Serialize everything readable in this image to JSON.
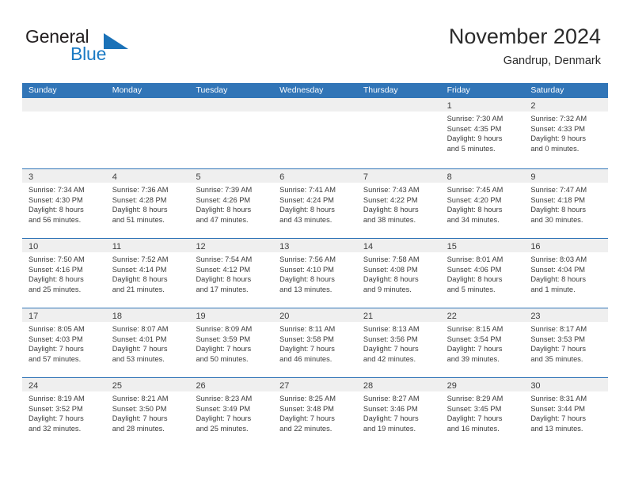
{
  "logo": {
    "word1": "General",
    "word2": "Blue",
    "triangle_icon": "triangle-icon",
    "color_dark": "#231f20",
    "color_blue": "#1b7ac4"
  },
  "header": {
    "title": "November 2024",
    "location": "Gandrup, Denmark"
  },
  "theme": {
    "header_blue": "#3175b7",
    "date_band_gray": "#efefef",
    "text": "#3c3c3c"
  },
  "calendar": {
    "weekdays": [
      "Sunday",
      "Monday",
      "Tuesday",
      "Wednesday",
      "Thursday",
      "Friday",
      "Saturday"
    ],
    "weeks": [
      [
        {
          "day": "",
          "empty": true
        },
        {
          "day": "",
          "empty": true
        },
        {
          "day": "",
          "empty": true
        },
        {
          "day": "",
          "empty": true
        },
        {
          "day": "",
          "empty": true
        },
        {
          "day": "1",
          "sunrise": "Sunrise: 7:30 AM",
          "sunset": "Sunset: 4:35 PM",
          "daylight1": "Daylight: 9 hours",
          "daylight2": "and 5 minutes."
        },
        {
          "day": "2",
          "sunrise": "Sunrise: 7:32 AM",
          "sunset": "Sunset: 4:33 PM",
          "daylight1": "Daylight: 9 hours",
          "daylight2": "and 0 minutes."
        }
      ],
      [
        {
          "day": "3",
          "sunrise": "Sunrise: 7:34 AM",
          "sunset": "Sunset: 4:30 PM",
          "daylight1": "Daylight: 8 hours",
          "daylight2": "and 56 minutes."
        },
        {
          "day": "4",
          "sunrise": "Sunrise: 7:36 AM",
          "sunset": "Sunset: 4:28 PM",
          "daylight1": "Daylight: 8 hours",
          "daylight2": "and 51 minutes."
        },
        {
          "day": "5",
          "sunrise": "Sunrise: 7:39 AM",
          "sunset": "Sunset: 4:26 PM",
          "daylight1": "Daylight: 8 hours",
          "daylight2": "and 47 minutes."
        },
        {
          "day": "6",
          "sunrise": "Sunrise: 7:41 AM",
          "sunset": "Sunset: 4:24 PM",
          "daylight1": "Daylight: 8 hours",
          "daylight2": "and 43 minutes."
        },
        {
          "day": "7",
          "sunrise": "Sunrise: 7:43 AM",
          "sunset": "Sunset: 4:22 PM",
          "daylight1": "Daylight: 8 hours",
          "daylight2": "and 38 minutes."
        },
        {
          "day": "8",
          "sunrise": "Sunrise: 7:45 AM",
          "sunset": "Sunset: 4:20 PM",
          "daylight1": "Daylight: 8 hours",
          "daylight2": "and 34 minutes."
        },
        {
          "day": "9",
          "sunrise": "Sunrise: 7:47 AM",
          "sunset": "Sunset: 4:18 PM",
          "daylight1": "Daylight: 8 hours",
          "daylight2": "and 30 minutes."
        }
      ],
      [
        {
          "day": "10",
          "sunrise": "Sunrise: 7:50 AM",
          "sunset": "Sunset: 4:16 PM",
          "daylight1": "Daylight: 8 hours",
          "daylight2": "and 25 minutes."
        },
        {
          "day": "11",
          "sunrise": "Sunrise: 7:52 AM",
          "sunset": "Sunset: 4:14 PM",
          "daylight1": "Daylight: 8 hours",
          "daylight2": "and 21 minutes."
        },
        {
          "day": "12",
          "sunrise": "Sunrise: 7:54 AM",
          "sunset": "Sunset: 4:12 PM",
          "daylight1": "Daylight: 8 hours",
          "daylight2": "and 17 minutes."
        },
        {
          "day": "13",
          "sunrise": "Sunrise: 7:56 AM",
          "sunset": "Sunset: 4:10 PM",
          "daylight1": "Daylight: 8 hours",
          "daylight2": "and 13 minutes."
        },
        {
          "day": "14",
          "sunrise": "Sunrise: 7:58 AM",
          "sunset": "Sunset: 4:08 PM",
          "daylight1": "Daylight: 8 hours",
          "daylight2": "and 9 minutes."
        },
        {
          "day": "15",
          "sunrise": "Sunrise: 8:01 AM",
          "sunset": "Sunset: 4:06 PM",
          "daylight1": "Daylight: 8 hours",
          "daylight2": "and 5 minutes."
        },
        {
          "day": "16",
          "sunrise": "Sunrise: 8:03 AM",
          "sunset": "Sunset: 4:04 PM",
          "daylight1": "Daylight: 8 hours",
          "daylight2": "and 1 minute."
        }
      ],
      [
        {
          "day": "17",
          "sunrise": "Sunrise: 8:05 AM",
          "sunset": "Sunset: 4:03 PM",
          "daylight1": "Daylight: 7 hours",
          "daylight2": "and 57 minutes."
        },
        {
          "day": "18",
          "sunrise": "Sunrise: 8:07 AM",
          "sunset": "Sunset: 4:01 PM",
          "daylight1": "Daylight: 7 hours",
          "daylight2": "and 53 minutes."
        },
        {
          "day": "19",
          "sunrise": "Sunrise: 8:09 AM",
          "sunset": "Sunset: 3:59 PM",
          "daylight1": "Daylight: 7 hours",
          "daylight2": "and 50 minutes."
        },
        {
          "day": "20",
          "sunrise": "Sunrise: 8:11 AM",
          "sunset": "Sunset: 3:58 PM",
          "daylight1": "Daylight: 7 hours",
          "daylight2": "and 46 minutes."
        },
        {
          "day": "21",
          "sunrise": "Sunrise: 8:13 AM",
          "sunset": "Sunset: 3:56 PM",
          "daylight1": "Daylight: 7 hours",
          "daylight2": "and 42 minutes."
        },
        {
          "day": "22",
          "sunrise": "Sunrise: 8:15 AM",
          "sunset": "Sunset: 3:54 PM",
          "daylight1": "Daylight: 7 hours",
          "daylight2": "and 39 minutes."
        },
        {
          "day": "23",
          "sunrise": "Sunrise: 8:17 AM",
          "sunset": "Sunset: 3:53 PM",
          "daylight1": "Daylight: 7 hours",
          "daylight2": "and 35 minutes."
        }
      ],
      [
        {
          "day": "24",
          "sunrise": "Sunrise: 8:19 AM",
          "sunset": "Sunset: 3:52 PM",
          "daylight1": "Daylight: 7 hours",
          "daylight2": "and 32 minutes."
        },
        {
          "day": "25",
          "sunrise": "Sunrise: 8:21 AM",
          "sunset": "Sunset: 3:50 PM",
          "daylight1": "Daylight: 7 hours",
          "daylight2": "and 28 minutes."
        },
        {
          "day": "26",
          "sunrise": "Sunrise: 8:23 AM",
          "sunset": "Sunset: 3:49 PM",
          "daylight1": "Daylight: 7 hours",
          "daylight2": "and 25 minutes."
        },
        {
          "day": "27",
          "sunrise": "Sunrise: 8:25 AM",
          "sunset": "Sunset: 3:48 PM",
          "daylight1": "Daylight: 7 hours",
          "daylight2": "and 22 minutes."
        },
        {
          "day": "28",
          "sunrise": "Sunrise: 8:27 AM",
          "sunset": "Sunset: 3:46 PM",
          "daylight1": "Daylight: 7 hours",
          "daylight2": "and 19 minutes."
        },
        {
          "day": "29",
          "sunrise": "Sunrise: 8:29 AM",
          "sunset": "Sunset: 3:45 PM",
          "daylight1": "Daylight: 7 hours",
          "daylight2": "and 16 minutes."
        },
        {
          "day": "30",
          "sunrise": "Sunrise: 8:31 AM",
          "sunset": "Sunset: 3:44 PM",
          "daylight1": "Daylight: 7 hours",
          "daylight2": "and 13 minutes."
        }
      ]
    ]
  }
}
